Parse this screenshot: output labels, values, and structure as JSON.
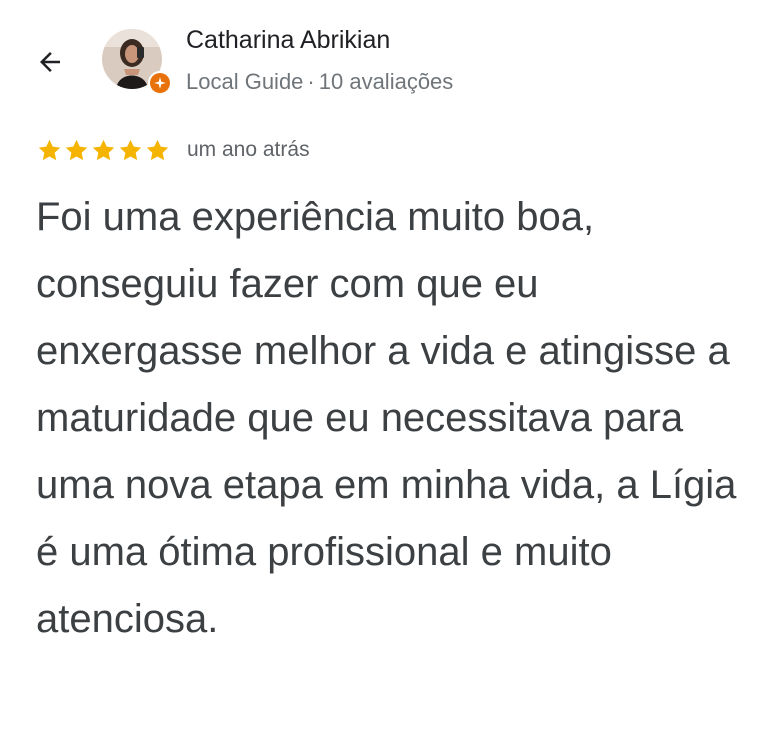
{
  "header": {
    "author_name": "Catharina Abrikian",
    "author_role": "Local Guide",
    "separator": "·",
    "review_count": "10 avaliações"
  },
  "icons": {
    "back": "arrow-left-icon",
    "badge": "local-guide-star-icon",
    "rating": "star-icon"
  },
  "review": {
    "rating": 5,
    "rating_max": 5,
    "date": "um ano atrás",
    "text": "Foi uma experiência muito boa, conseguiu fazer com que eu enxergasse melhor a vida e atingisse a maturidade que eu necessitava para uma nova etapa em minha vida, a Lígia é uma ótima profissional e muito atenciosa."
  },
  "colors": {
    "star": "#f4b400",
    "badge": "#e8710a",
    "text": "#3c4043",
    "secondary_text": "#70757a"
  }
}
